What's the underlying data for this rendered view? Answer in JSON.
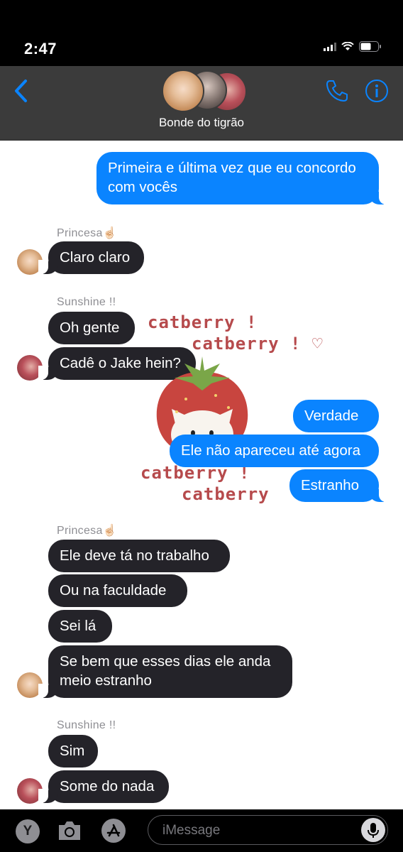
{
  "status_bar": {
    "time": "2:47"
  },
  "header": {
    "group_name": "Bonde do tigrão"
  },
  "messages": [
    {
      "direction": "out",
      "text": "Primeira e última vez que eu concordo com vocês"
    },
    {
      "direction": "in",
      "sender": "Princesa☝🏻",
      "text": "Claro claro"
    },
    {
      "direction": "in",
      "sender": "Sunshine !!",
      "text": "Oh gente"
    },
    {
      "direction": "in",
      "text": "Cadê o Jake hein?"
    },
    {
      "direction": "out",
      "text": "Verdade"
    },
    {
      "direction": "out",
      "text": "Ele não apareceu até agora"
    },
    {
      "direction": "out",
      "text": "Estranho"
    },
    {
      "direction": "in",
      "sender": "Princesa☝🏻",
      "text": "Ele deve tá no trabalho"
    },
    {
      "direction": "in",
      "text": "Ou na faculdade"
    },
    {
      "direction": "in",
      "text": "Sei lá"
    },
    {
      "direction": "in",
      "text": "Se bem que esses dias ele anda meio estranho"
    },
    {
      "direction": "in",
      "sender": "Sunshine !!",
      "text": "Sim"
    },
    {
      "direction": "in",
      "text": "Some do nada"
    }
  ],
  "sticker": {
    "line1": "catberry !",
    "line2": "catberry ! ♡",
    "line3": "catberry !",
    "line4": "catberry"
  },
  "input_bar": {
    "placeholder": "iMessage",
    "apps_label": "Y"
  },
  "colors": {
    "outgoing": "#0a84ff",
    "incoming": "#242329",
    "header": "#3b3b3b",
    "accent": "#0a84ff"
  }
}
